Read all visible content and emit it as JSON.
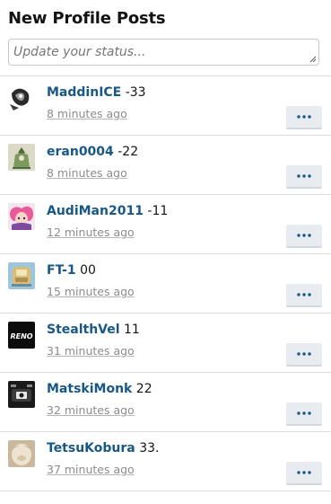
{
  "widget": {
    "title": "New Profile Posts",
    "status_placeholder": "Update your status..."
  },
  "posts": [
    {
      "username": "MaddinICE",
      "text": "-33",
      "time": "8 minutes ago"
    },
    {
      "username": "eran0004",
      "text": "-22",
      "time": "8 minutes ago"
    },
    {
      "username": "AudiMan2011",
      "text": "-11",
      "time": "12 minutes ago"
    },
    {
      "username": "FT-1",
      "text": "00",
      "time": "15 minutes ago"
    },
    {
      "username": "StealthVel",
      "text": "11",
      "time": "31 minutes ago"
    },
    {
      "username": "MatskiMonk",
      "text": "22",
      "time": "32 minutes ago"
    },
    {
      "username": "TetsuKobura",
      "text": "33.",
      "time": "37 minutes ago"
    }
  ],
  "icons": {
    "more": "ellipsis-icon",
    "resize": "resize-grip-icon"
  },
  "colors": {
    "username": "#185886",
    "timestamp": "#8c8c8c",
    "button_bg": "#e8ecf0",
    "button_dots": "#185886"
  }
}
